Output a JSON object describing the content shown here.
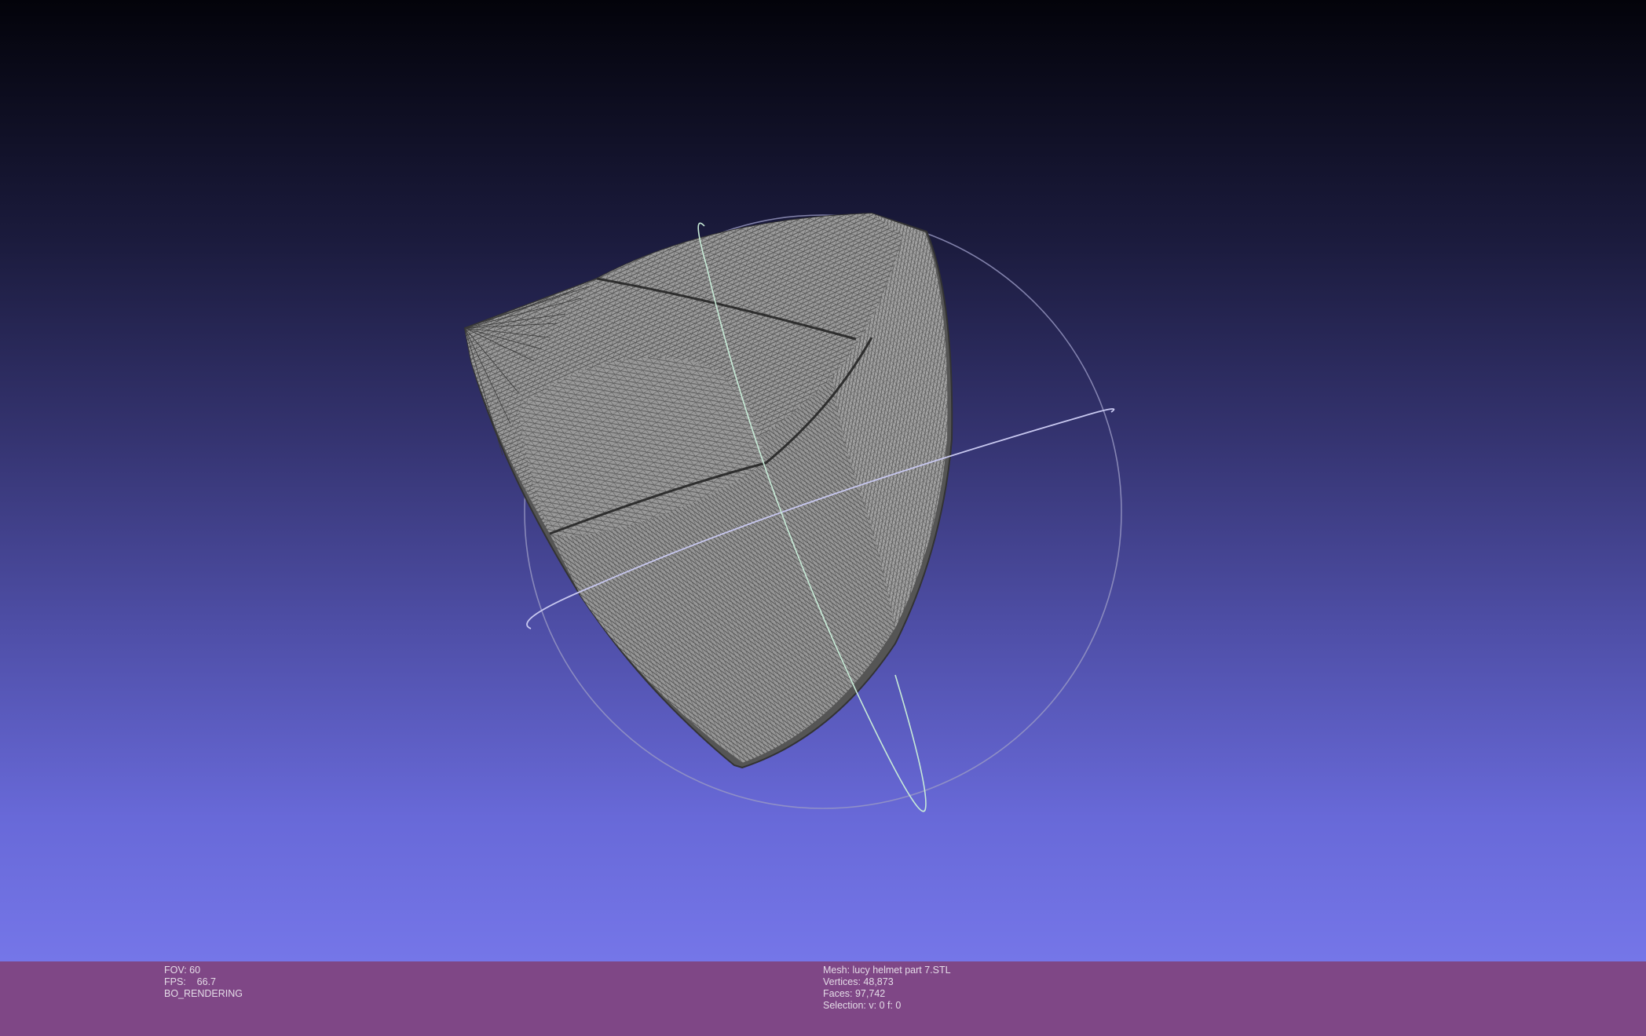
{
  "viewport": {
    "background_top": "#03030a",
    "background_bottom": "#7576e8",
    "mesh_color": "#8a8a8a",
    "wire_color": "#4a4a4a",
    "trackball_colors": [
      "#9a9ac4",
      "#c8c8f0",
      "#c8ecd8"
    ]
  },
  "status": {
    "left": {
      "fov": "FOV: 60",
      "fps": "FPS:    66.7",
      "mode": "BO_RENDERING"
    },
    "right": {
      "mesh": "Mesh: lucy helmet part 7.STL",
      "vertices": "Vertices: 48,873",
      "faces": "Faces: 97,742",
      "selection": "Selection: v: 0 f: 0"
    }
  },
  "info_bar_color": "#7f4786"
}
